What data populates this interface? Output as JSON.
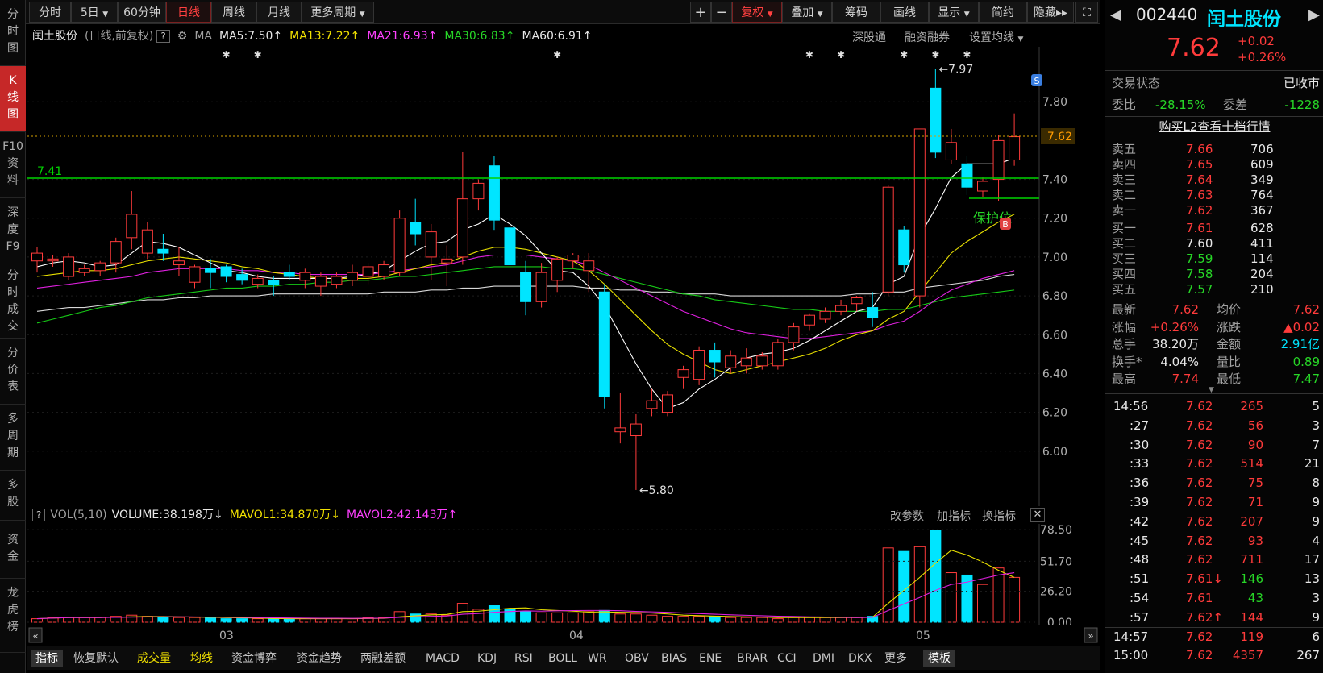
{
  "toolbar": {
    "tabs": [
      "分时",
      "5日",
      "60分钟",
      "日线",
      "周线",
      "月线",
      "更多周期"
    ],
    "active": "日线",
    "plus": "+",
    "minus": "−",
    "fuquan": "复权",
    "overlay": "叠加",
    "chips": "筹码",
    "draw": "画线",
    "display": "显示",
    "simple": "简约",
    "hide": "隐藏"
  },
  "leftnav": [
    {
      "label": "分\n时\n图"
    },
    {
      "label": "K\n线\n图"
    },
    {
      "label": "F10\n资\n料"
    },
    {
      "label": "深\n度\nF9"
    },
    {
      "label": "分\n时\n成\n交"
    },
    {
      "label": "分\n价\n表"
    },
    {
      "label": "多\n周\n期"
    },
    {
      "label": "多\n股"
    },
    {
      "label": "资\n金"
    },
    {
      "label": "龙\n虎\n榜"
    }
  ],
  "chart_header": {
    "name": "闰土股份",
    "mode": "(日线,前复权)",
    "help": "?",
    "ma_label": "MA",
    "ma5": "MA5:7.50",
    "ma13": "MA13:7.22",
    "ma21": "MA21:6.93",
    "ma30": "MA30:6.83",
    "ma60": "MA60:6.91",
    "links": [
      "深股通",
      "融资融券",
      "设置均线"
    ]
  },
  "annotations": {
    "hline": "7.41",
    "high": "7.97",
    "low": "5.80",
    "protect": "保护位",
    "sell_tag": "S",
    "buy_tag": "B",
    "current_price_tag": "7.62"
  },
  "y_ticks": [
    "7.80",
    "7.40",
    "7.20",
    "7.00",
    "6.80",
    "6.60",
    "6.40",
    "6.20",
    "6.00"
  ],
  "x_ticks": [
    "03",
    "04",
    "05"
  ],
  "vol_header": {
    "help": "?",
    "vol": "VOL(5,10)",
    "volume": "VOLUME:38.198万",
    "mavol1": "MAVOL1:34.870万",
    "mavol2": "MAVOL2:42.143万",
    "links": [
      "改参数",
      "加指标",
      "换指标"
    ]
  },
  "vol_ticks": [
    "78.50",
    "51.70",
    "26.20",
    "0.00"
  ],
  "bottom_tabs": [
    "指标",
    "恢复默认",
    "成交量",
    "均线",
    "资金博弈",
    "资金趋势",
    "两融差额",
    "MACD",
    "KDJ",
    "RSI",
    "BOLL",
    "WR",
    "OBV",
    "BIAS",
    "ENE",
    "BRAR",
    "CCI",
    "DMI",
    "DKX",
    "更多",
    "模板"
  ],
  "stock": {
    "code": "002440",
    "name": "闰土股份",
    "price": "7.62",
    "change": "+0.02",
    "change_pct": "+0.26%"
  },
  "status": {
    "label": "交易状态",
    "value": "已收市",
    "weibi_label": "委比",
    "weibi": "-28.15%",
    "weicha_label": "委差",
    "weicha": "-1228",
    "l2": "购买L2查看十档行情"
  },
  "asks": [
    {
      "label": "卖五",
      "price": "7.66",
      "vol": "706"
    },
    {
      "label": "卖四",
      "price": "7.65",
      "vol": "609"
    },
    {
      "label": "卖三",
      "price": "7.64",
      "vol": "349"
    },
    {
      "label": "卖二",
      "price": "7.63",
      "vol": "764"
    },
    {
      "label": "卖一",
      "price": "7.62",
      "vol": "367"
    }
  ],
  "bids": [
    {
      "label": "买一",
      "price": "7.61",
      "vol": "628"
    },
    {
      "label": "买二",
      "price": "7.60",
      "vol": "411"
    },
    {
      "label": "买三",
      "price": "7.59",
      "vol": "114"
    },
    {
      "label": "买四",
      "price": "7.58",
      "vol": "204"
    },
    {
      "label": "买五",
      "price": "7.57",
      "vol": "210"
    }
  ],
  "stats": [
    {
      "l1": "最新",
      "v1": "7.62",
      "l2": "均价",
      "v2": "7.62"
    },
    {
      "l1": "涨幅",
      "v1": "+0.26%",
      "l2": "涨跌",
      "v2": "▲0.02"
    },
    {
      "l1": "总手",
      "v1": "38.20万",
      "l2": "金额",
      "v2": "2.91亿"
    },
    {
      "l1": "换手*",
      "v1": "4.04%",
      "l2": "量比",
      "v2": "0.89"
    },
    {
      "l1": "最高",
      "v1": "7.74",
      "l2": "最低",
      "v2": "7.47"
    }
  ],
  "ticks": [
    {
      "t": "14:56",
      "p": "7.62",
      "v": "265",
      "n": "5"
    },
    {
      "t": ":27",
      "p": "7.62",
      "v": "56",
      "n": "3"
    },
    {
      "t": ":30",
      "p": "7.62",
      "v": "90",
      "n": "7"
    },
    {
      "t": ":33",
      "p": "7.62",
      "v": "514",
      "n": "21"
    },
    {
      "t": ":36",
      "p": "7.62",
      "v": "75",
      "n": "8"
    },
    {
      "t": ":39",
      "p": "7.62",
      "v": "71",
      "n": "9"
    },
    {
      "t": ":42",
      "p": "7.62",
      "v": "207",
      "n": "9"
    },
    {
      "t": ":45",
      "p": "7.62",
      "v": "93",
      "n": "4"
    },
    {
      "t": ":48",
      "p": "7.62",
      "v": "711",
      "n": "17"
    },
    {
      "t": ":51",
      "p": "7.61↓",
      "v": "146",
      "n": "13"
    },
    {
      "t": ":54",
      "p": "7.61",
      "v": "43",
      "n": "3"
    },
    {
      "t": ":57",
      "p": "7.62↑",
      "v": "144",
      "n": "9"
    },
    {
      "t": "14:57",
      "p": "7.62",
      "v": "119",
      "n": "6"
    },
    {
      "t": "15:00",
      "p": "7.62",
      "v": "4357",
      "n": "267"
    }
  ],
  "chart_data": {
    "type": "candlestick",
    "x_labels": [
      "03",
      "04",
      "05"
    ],
    "ylim": [
      5.75,
      8.05
    ],
    "candles": [
      [
        6.98,
        7.02,
        6.92,
        7.05
      ],
      [
        6.98,
        6.99,
        6.95,
        7.01
      ],
      [
        6.9,
        7.0,
        6.88,
        7.02
      ],
      [
        6.92,
        6.94,
        6.9,
        6.96
      ],
      [
        6.93,
        6.97,
        6.9,
        6.98
      ],
      [
        6.97,
        7.08,
        6.92,
        7.1
      ],
      [
        7.1,
        7.22,
        7.04,
        7.34
      ],
      [
        7.02,
        7.14,
        6.99,
        7.18
      ],
      [
        7.04,
        7.02,
        6.98,
        7.12
      ],
      [
        6.96,
        6.98,
        6.9,
        7.05
      ],
      [
        6.87,
        6.95,
        6.84,
        6.96
      ],
      [
        6.94,
        6.92,
        6.84,
        6.99
      ],
      [
        6.95,
        6.9,
        6.87,
        6.96
      ],
      [
        6.91,
        6.88,
        6.86,
        6.94
      ],
      [
        6.86,
        6.89,
        6.84,
        6.91
      ],
      [
        6.88,
        6.86,
        6.8,
        6.9
      ],
      [
        6.92,
        6.9,
        6.88,
        6.96
      ],
      [
        6.88,
        6.92,
        6.84,
        6.94
      ],
      [
        6.85,
        6.9,
        6.8,
        6.92
      ],
      [
        6.86,
        6.9,
        6.84,
        6.92
      ],
      [
        6.88,
        6.92,
        6.85,
        6.96
      ],
      [
        6.9,
        6.95,
        6.86,
        6.97
      ],
      [
        6.9,
        6.96,
        6.88,
        6.98
      ],
      [
        6.92,
        7.2,
        6.9,
        7.24
      ],
      [
        7.18,
        7.12,
        7.06,
        7.3
      ],
      [
        7.0,
        7.13,
        6.88,
        7.17
      ],
      [
        6.97,
        6.99,
        6.85,
        7.06
      ],
      [
        7.0,
        7.3,
        6.96,
        7.54
      ],
      [
        7.3,
        7.38,
        7.24,
        7.4
      ],
      [
        7.47,
        7.19,
        7.14,
        7.52
      ],
      [
        7.15,
        6.96,
        6.93,
        7.19
      ],
      [
        6.92,
        6.77,
        6.7,
        6.98
      ],
      [
        6.77,
        6.92,
        6.74,
        6.97
      ],
      [
        6.88,
        6.99,
        6.82,
        7.0
      ],
      [
        6.98,
        7.01,
        6.94,
        7.02
      ],
      [
        6.93,
        6.98,
        6.82,
        7.02
      ],
      [
        6.82,
        6.28,
        6.22,
        6.86
      ],
      [
        6.1,
        6.12,
        6.04,
        6.3
      ],
      [
        6.08,
        6.14,
        5.8,
        6.19
      ],
      [
        6.22,
        6.26,
        6.18,
        6.32
      ],
      [
        6.2,
        6.29,
        6.18,
        6.31
      ],
      [
        6.38,
        6.42,
        6.32,
        6.44
      ],
      [
        6.37,
        6.52,
        6.34,
        6.54
      ],
      [
        6.52,
        6.46,
        6.38,
        6.56
      ],
      [
        6.43,
        6.49,
        6.4,
        6.52
      ],
      [
        6.44,
        6.48,
        6.4,
        6.53
      ],
      [
        6.44,
        6.49,
        6.42,
        6.51
      ],
      [
        6.44,
        6.56,
        6.42,
        6.58
      ],
      [
        6.56,
        6.64,
        6.52,
        6.66
      ],
      [
        6.65,
        6.7,
        6.62,
        6.71
      ],
      [
        6.68,
        6.72,
        6.66,
        6.74
      ],
      [
        6.72,
        6.75,
        6.7,
        6.78
      ],
      [
        6.76,
        6.79,
        6.72,
        6.8
      ],
      [
        6.74,
        6.69,
        6.64,
        6.82
      ],
      [
        6.82,
        7.36,
        6.8,
        7.37
      ],
      [
        7.14,
        6.96,
        6.92,
        7.16
      ],
      [
        6.8,
        7.66,
        6.74,
        7.66
      ],
      [
        7.87,
        7.54,
        7.51,
        7.97
      ],
      [
        7.5,
        7.59,
        7.48,
        7.66
      ],
      [
        7.48,
        7.36,
        7.32,
        7.52
      ],
      [
        7.34,
        7.39,
        7.31,
        7.41
      ],
      [
        7.4,
        7.6,
        7.29,
        7.63
      ],
      [
        7.5,
        7.62,
        7.47,
        7.74
      ]
    ],
    "ma5": [
      6.95,
      6.97,
      6.98,
      6.97,
      6.95,
      6.96,
      7.02,
      7.08,
      7.07,
      7.05,
      7.01,
      6.97,
      6.93,
      6.92,
      6.9,
      6.89,
      6.89,
      6.89,
      6.89,
      6.89,
      6.9,
      6.91,
      6.93,
      6.98,
      7.03,
      7.07,
      7.08,
      7.14,
      7.17,
      7.22,
      7.17,
      7.11,
      7.02,
      6.93,
      6.92,
      6.85,
      6.75,
      6.6,
      6.45,
      6.32,
      6.22,
      6.25,
      6.32,
      6.37,
      6.43,
      6.48,
      6.5,
      6.51,
      6.53,
      6.57,
      6.62,
      6.67,
      6.72,
      6.74,
      6.86,
      6.9,
      7.11,
      7.25,
      7.41,
      7.48,
      7.48,
      7.48,
      7.51
    ],
    "ma13": [
      6.9,
      6.91,
      6.92,
      6.93,
      6.93,
      6.94,
      6.96,
      6.98,
      6.99,
      7.0,
      6.99,
      6.98,
      6.97,
      6.95,
      6.94,
      6.92,
      6.91,
      6.9,
      6.89,
      6.89,
      6.89,
      6.89,
      6.9,
      6.92,
      6.94,
      6.96,
      6.97,
      7.0,
      7.03,
      7.05,
      7.05,
      7.04,
      7.02,
      7.0,
      6.98,
      6.93,
      6.86,
      6.78,
      6.7,
      6.62,
      6.55,
      6.5,
      6.46,
      6.42,
      6.4,
      6.42,
      6.44,
      6.46,
      6.48,
      6.5,
      6.53,
      6.57,
      6.6,
      6.62,
      6.68,
      6.72,
      6.82,
      6.92,
      7.02,
      7.08,
      7.13,
      7.18,
      7.22
    ],
    "ma21": [
      6.84,
      6.85,
      6.86,
      6.87,
      6.88,
      6.89,
      6.9,
      6.92,
      6.93,
      6.94,
      6.94,
      6.94,
      6.94,
      6.93,
      6.93,
      6.92,
      6.92,
      6.91,
      6.91,
      6.91,
      6.91,
      6.91,
      6.92,
      6.93,
      6.94,
      6.95,
      6.96,
      6.98,
      7.0,
      7.01,
      7.01,
      7.01,
      7.0,
      6.99,
      6.98,
      6.96,
      6.92,
      6.88,
      6.84,
      6.8,
      6.76,
      6.72,
      6.69,
      6.66,
      6.63,
      6.61,
      6.6,
      6.59,
      6.58,
      6.58,
      6.59,
      6.6,
      6.61,
      6.62,
      6.65,
      6.67,
      6.72,
      6.78,
      6.83,
      6.86,
      6.89,
      6.91,
      6.93
    ],
    "ma30": [
      6.66,
      6.68,
      6.7,
      6.72,
      6.74,
      6.75,
      6.77,
      6.79,
      6.8,
      6.81,
      6.82,
      6.83,
      6.84,
      6.84,
      6.85,
      6.85,
      6.86,
      6.86,
      6.87,
      6.87,
      6.88,
      6.88,
      6.89,
      6.9,
      6.9,
      6.91,
      6.92,
      6.93,
      6.94,
      6.95,
      6.95,
      6.95,
      6.95,
      6.94,
      6.94,
      6.93,
      6.91,
      6.89,
      6.87,
      6.85,
      6.83,
      6.81,
      6.8,
      6.78,
      6.77,
      6.76,
      6.75,
      6.74,
      6.73,
      6.73,
      6.72,
      6.72,
      6.72,
      6.72,
      6.73,
      6.73,
      6.75,
      6.77,
      6.79,
      6.8,
      6.81,
      6.82,
      6.83
    ],
    "ma60": [
      6.72,
      6.73,
      6.74,
      6.74,
      6.75,
      6.76,
      6.77,
      6.78,
      6.78,
      6.79,
      6.79,
      6.8,
      6.8,
      6.8,
      6.8,
      6.81,
      6.81,
      6.81,
      6.81,
      6.81,
      6.81,
      6.81,
      6.82,
      6.82,
      6.82,
      6.83,
      6.83,
      6.84,
      6.84,
      6.85,
      6.85,
      6.85,
      6.85,
      6.85,
      6.85,
      6.84,
      6.84,
      6.83,
      6.83,
      6.82,
      6.82,
      6.81,
      6.81,
      6.81,
      6.8,
      6.8,
      6.8,
      6.8,
      6.8,
      6.8,
      6.8,
      6.8,
      6.81,
      6.81,
      6.82,
      6.82,
      6.84,
      6.85,
      6.86,
      6.87,
      6.88,
      6.9,
      6.91
    ],
    "volume": [
      3,
      4,
      4,
      4,
      4,
      5,
      6,
      5,
      4,
      4,
      4,
      4,
      3,
      3,
      3,
      3,
      3,
      3,
      3,
      3,
      3,
      4,
      4,
      9,
      7,
      7,
      6,
      16,
      11,
      14,
      11,
      9,
      8,
      8,
      8,
      9,
      10,
      7,
      7,
      6,
      5,
      5,
      5,
      5,
      4,
      4,
      4,
      3,
      4,
      4,
      4,
      4,
      4,
      5,
      63,
      60,
      64,
      78,
      42,
      40,
      32,
      46,
      38
    ],
    "mavol1": [
      3,
      3.5,
      4,
      4,
      4,
      4.2,
      4.6,
      4.8,
      4.8,
      4.6,
      4.4,
      4.2,
      4,
      3.8,
      3.5,
      3.2,
      3,
      3,
      3,
      3,
      3,
      3.2,
      3.4,
      4.6,
      5.4,
      6.2,
      6.6,
      9,
      9.4,
      10.6,
      11.8,
      12.2,
      10.6,
      10,
      9.4,
      8.6,
      8.8,
      8.4,
      8.2,
      7.8,
      7,
      6,
      5.6,
      5.2,
      4.8,
      4.6,
      4.4,
      4,
      4,
      4,
      4,
      4,
      4,
      4.2,
      16,
      27,
      38,
      50,
      61,
      57,
      51,
      44,
      38
    ],
    "mavol2": [
      3,
      3.5,
      4,
      4,
      4,
      4.1,
      4.3,
      4.5,
      4.6,
      4.6,
      4.5,
      4.4,
      4.3,
      4.1,
      3.9,
      3.8,
      3.6,
      3.5,
      3.4,
      3.4,
      3.3,
      3.4,
      3.5,
      4.1,
      4.6,
      5,
      5.3,
      6.8,
      7.4,
      8.4,
      9.1,
      9.6,
      9.4,
      9.7,
      9.9,
      10,
      10,
      9.8,
      9.2,
      8.8,
      8.4,
      7.8,
      7.3,
      6.8,
      6.3,
      5.9,
      5.5,
      5.1,
      4.9,
      4.6,
      4.4,
      4.2,
      4,
      4.1,
      10,
      15.5,
      21,
      27,
      32,
      34,
      37,
      40,
      42
    ]
  }
}
